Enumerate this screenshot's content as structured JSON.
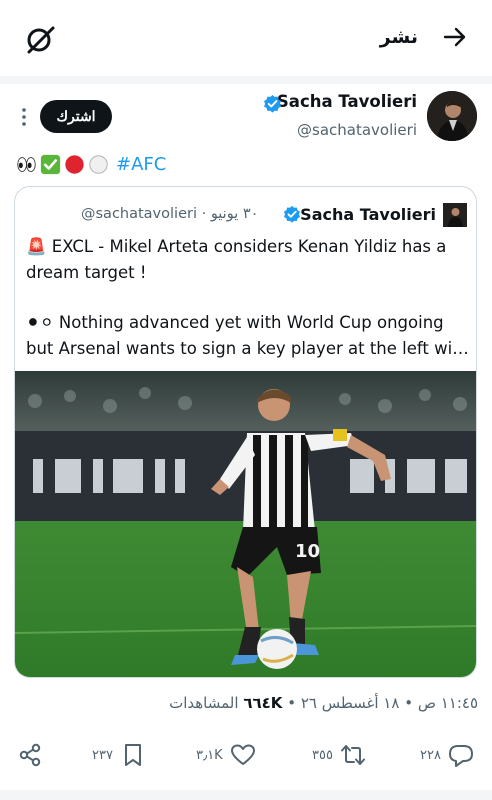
{
  "header": {
    "title": "نشر",
    "back_icon": "arrow-right-icon",
    "grok_icon": "grok-icon"
  },
  "post": {
    "author_name": "Sacha Tavolieri",
    "handle": "@sachatavolieri",
    "subscribe_label": "اشترك",
    "emoji_sequence": [
      "eyes-emoji",
      "check-mark-emoji",
      "red-circle-emoji",
      "white-circle-emoji"
    ],
    "hashtag": "#AFC",
    "accent_color": "#1d9bf0"
  },
  "quote": {
    "author_name": "Sacha Tavolieri",
    "handle": "@sachatavolieri",
    "date": "٣٠ يونيو",
    "line1": "🚨 EXCL - Mikel Arteta considers Kenan Yildiz has a",
    "line2": "dream target !",
    "line3": "⚫⚪ Nothing advanced yet with World Cup ongoing",
    "line4": "but Arsenal wants to sign a key player at the left wi…"
  },
  "meta": {
    "time": "١١:٤٥ ص",
    "date": "١٨ أغسطس ٢٦",
    "views_count": "٦٦٤K",
    "views_label": "المشاهدات"
  },
  "actions": {
    "reply_count": "٢٢٨",
    "repost_count": "٣٥٥",
    "like_count": "٣٫١K",
    "bookmark_count": "٢٣٧"
  }
}
